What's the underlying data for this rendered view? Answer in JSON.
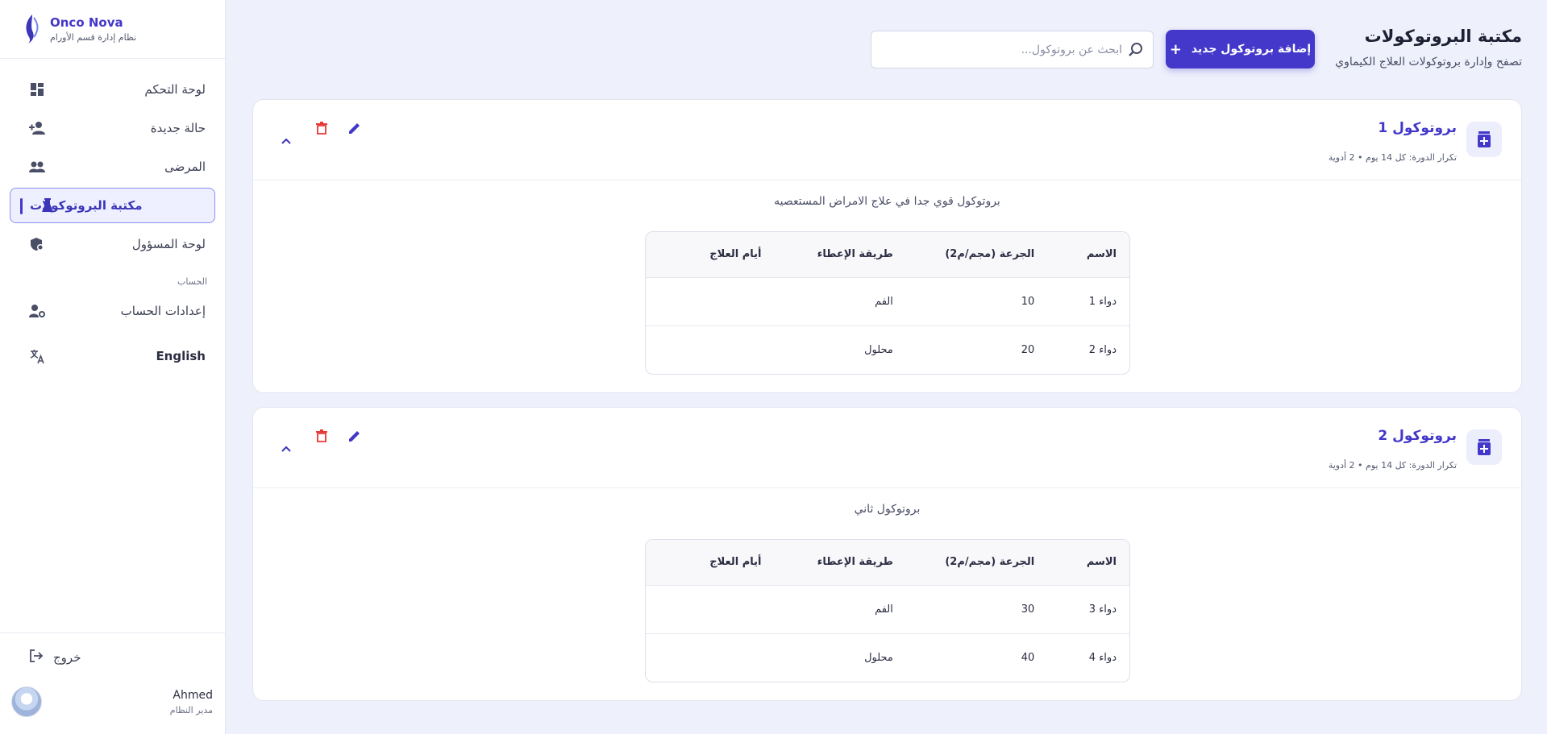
{
  "brand": {
    "name": "Onco Nova",
    "subtitle": "نظام إدارة قسم الأورام"
  },
  "sidebar": {
    "items": [
      {
        "label": "لوحة التحكم",
        "icon": "dashboard-icon"
      },
      {
        "label": "حالة جديدة",
        "icon": "person-add-icon"
      },
      {
        "label": "المرضى",
        "icon": "people-icon"
      },
      {
        "label": "مكتبة البروتوكولات",
        "icon": "flask-icon",
        "active": true
      },
      {
        "label": "لوحة المسؤول",
        "icon": "admin-shield-icon"
      }
    ],
    "section_label": "الحساب",
    "account_items": [
      {
        "label": "إعدادات الحساب",
        "icon": "manage-account-icon"
      },
      {
        "label": "English",
        "icon": "translate-icon"
      }
    ],
    "logout_label": "خروج",
    "user": {
      "name": "Ahmed",
      "role": "مدير النظام"
    }
  },
  "header": {
    "title": "مكتبة البروتوكولات",
    "subtitle": "تصفح وإدارة بروتوكولات العلاج الكيماوي",
    "add_button": "إضافة بروتوكول جديد",
    "search_placeholder": "ابحث عن بروتوكول..."
  },
  "table_headers": [
    "الاسم",
    "الجرعة (مجم/م2)",
    "طريقة الإعطاء",
    "أيام العلاج"
  ],
  "protocols": [
    {
      "title": "بروتوكول 1",
      "meta": "تكرار الدورة: كل 14 يوم • 2 أدوية",
      "description": "بروتوكول قوي جدا في علاج الامراض المستعصيه",
      "rows": [
        {
          "name": "دواء 1",
          "dose": "10",
          "route": "الفم",
          "days": ""
        },
        {
          "name": "دواء 2",
          "dose": "20",
          "route": "محلول",
          "days": ""
        }
      ]
    },
    {
      "title": "بروتوكول 2",
      "meta": "تكرار الدورة: كل 14 يوم • 2 أدوية",
      "description": "بروتوكول ثاني",
      "rows": [
        {
          "name": "دواء 3",
          "dose": "30",
          "route": "الفم",
          "days": ""
        },
        {
          "name": "دواء 4",
          "dose": "40",
          "route": "محلول",
          "days": ""
        }
      ]
    }
  ],
  "colors": {
    "accent": "#4338ca",
    "danger": "#e53935",
    "background": "#eef0fb"
  }
}
